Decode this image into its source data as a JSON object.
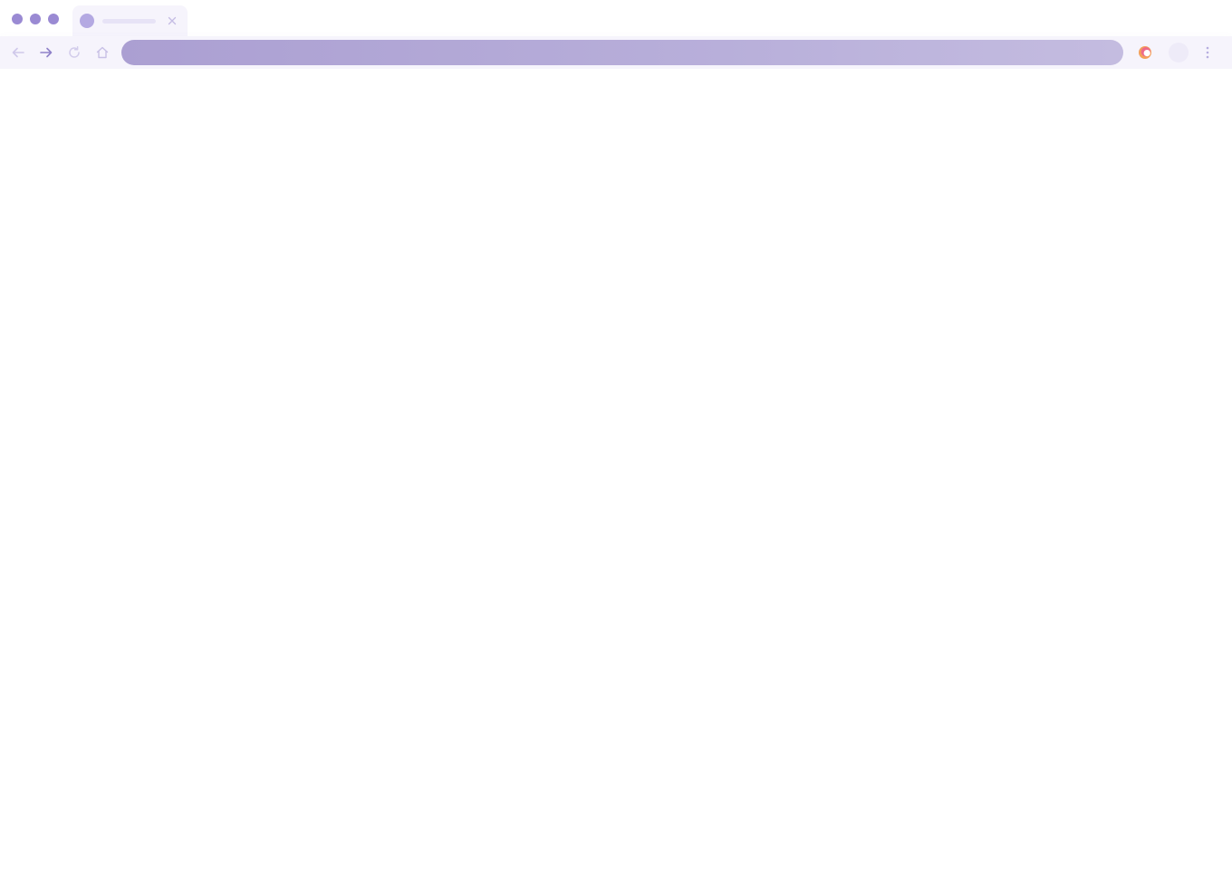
{
  "window": {
    "controls": [
      "close",
      "minimize",
      "maximize"
    ]
  },
  "tab": {
    "title": "",
    "favicon_icon": "favicon-circle-icon",
    "close_icon": "close-icon"
  },
  "toolbar": {
    "back_icon": "arrow-left-icon",
    "forward_icon": "arrow-right-icon",
    "reload_icon": "reload-icon",
    "home_icon": "home-icon",
    "address": {
      "value": "",
      "placeholder": ""
    },
    "extension_icon": "extension-icon",
    "profile_icon": "avatar-icon",
    "menu_icon": "kebab-menu-icon"
  },
  "colors": {
    "accent": "#9a8ad3",
    "tab_background": "#f6f4fc",
    "toolbar_background": "#f6f4fc",
    "omnibox_start": "#ab9fd2",
    "omnibox_end": "#c4bce0",
    "icon_muted": "#c8c0e6",
    "icon_active": "#8f81c9"
  }
}
